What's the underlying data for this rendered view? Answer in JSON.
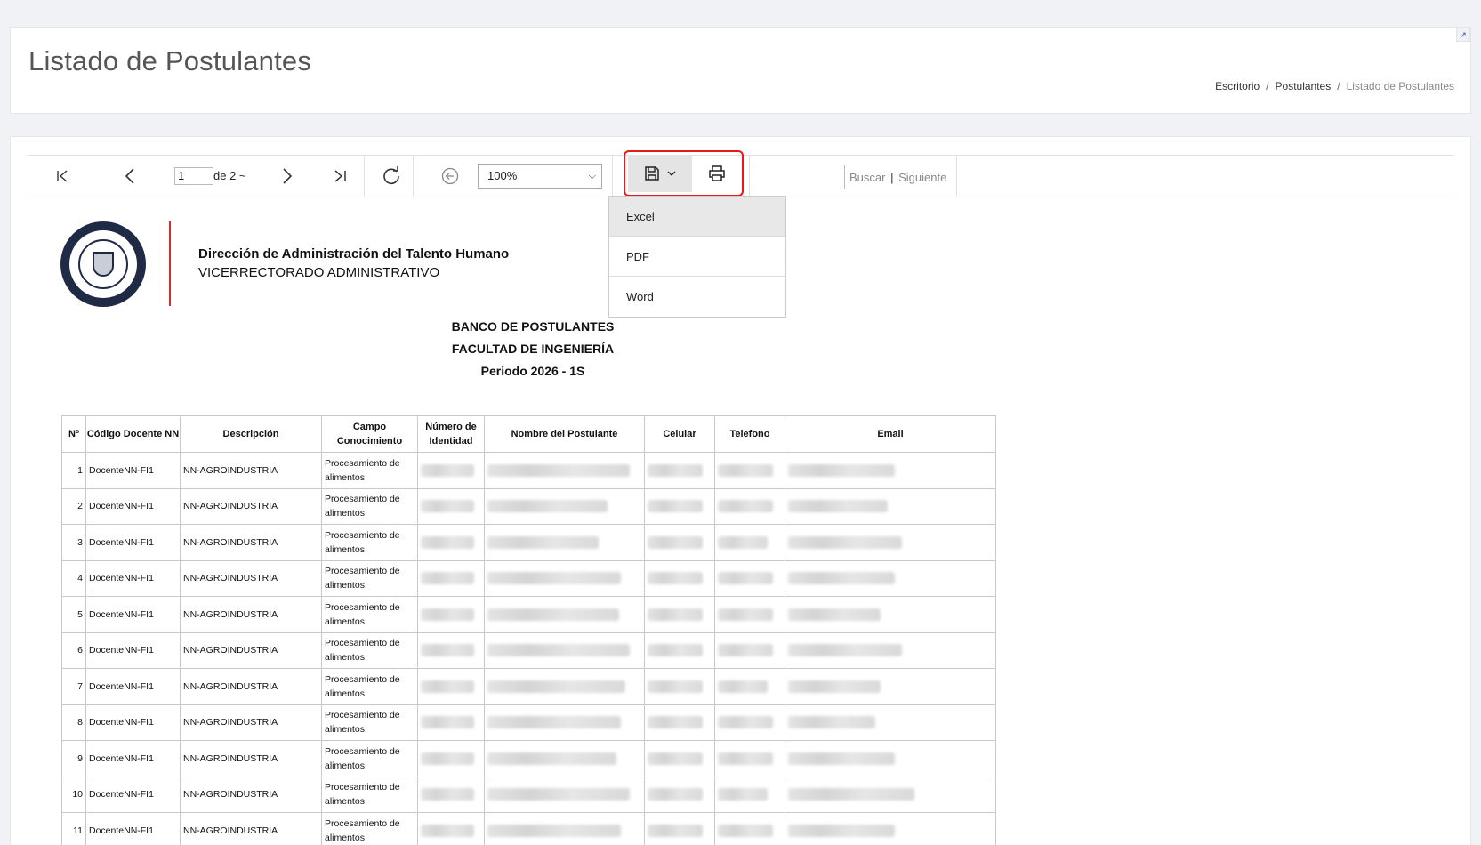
{
  "page": {
    "title": "Listado de Postulantes",
    "breadcrumb": [
      "Escritorio",
      "Postulantes",
      "Listado de Postulantes"
    ]
  },
  "toolbar": {
    "page_value": "1",
    "page_of": "de 2 ~",
    "zoom": "100%",
    "search_label": "Buscar",
    "search_separator": "|",
    "next_label": "Siguiente",
    "save_menu": [
      "Excel",
      "PDF",
      "Word"
    ],
    "save_menu_active": "Excel"
  },
  "report": {
    "org_title": "Dirección de Administración del Talento Humano",
    "org_subtitle": "VICERRECTORADO ADMINISTRATIVO",
    "titles": [
      "BANCO DE POSTULANTES",
      "FACULTAD DE INGENIERÍA",
      "Periodo 2026 - 1S"
    ],
    "columns": [
      "Nº",
      "Código Docente NN",
      "Descripción",
      "Campo Conocimiento",
      "Número de Identidad",
      "Nombre del Postulante",
      "Celular",
      "Telefono",
      "Email"
    ],
    "rows": [
      {
        "n": "1",
        "code": "DocenteNN-FI1",
        "desc": "NN-AGROINDUSTRIA",
        "field": "Procesamiento de alimentos"
      },
      {
        "n": "2",
        "code": "DocenteNN-FI1",
        "desc": "NN-AGROINDUSTRIA",
        "field": "Procesamiento de alimentos"
      },
      {
        "n": "3",
        "code": "DocenteNN-FI1",
        "desc": "NN-AGROINDUSTRIA",
        "field": "Procesamiento de alimentos"
      },
      {
        "n": "4",
        "code": "DocenteNN-FI1",
        "desc": "NN-AGROINDUSTRIA",
        "field": "Procesamiento de alimentos"
      },
      {
        "n": "5",
        "code": "DocenteNN-FI1",
        "desc": "NN-AGROINDUSTRIA",
        "field": "Procesamiento de alimentos"
      },
      {
        "n": "6",
        "code": "DocenteNN-FI1",
        "desc": "NN-AGROINDUSTRIA",
        "field": "Procesamiento de alimentos"
      },
      {
        "n": "7",
        "code": "DocenteNN-FI1",
        "desc": "NN-AGROINDUSTRIA",
        "field": "Procesamiento de alimentos"
      },
      {
        "n": "8",
        "code": "DocenteNN-FI1",
        "desc": "NN-AGROINDUSTRIA",
        "field": "Procesamiento de alimentos"
      },
      {
        "n": "9",
        "code": "DocenteNN-FI1",
        "desc": "NN-AGROINDUSTRIA",
        "field": "Procesamiento de alimentos"
      },
      {
        "n": "10",
        "code": "DocenteNN-FI1",
        "desc": "NN-AGROINDUSTRIA",
        "field": "Procesamiento de alimentos"
      },
      {
        "n": "11",
        "code": "DocenteNN-FI1",
        "desc": "NN-AGROINDUSTRIA",
        "field": "Procesamiento de alimentos"
      }
    ]
  }
}
